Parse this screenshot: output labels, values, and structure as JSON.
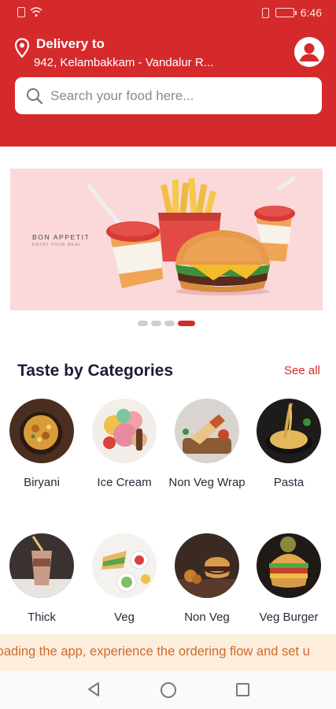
{
  "status_bar": {
    "time": "6:46",
    "icons": [
      "sim-icon",
      "wifi-icon",
      "vibrate-icon",
      "battery-icon"
    ]
  },
  "header": {
    "delivery_label": "Delivery to",
    "address": "942, Kelambakkam - Vandalur R...",
    "icons": [
      "location-pin-icon",
      "profile-icon"
    ]
  },
  "search": {
    "placeholder": "Search your food here...",
    "value": ""
  },
  "banner": {
    "heading": "BON APPETIT",
    "subtext": "ENJOY YOUR MEAL",
    "slides_total": 4,
    "active_slide": 4
  },
  "categories": {
    "title": "Taste by Categories",
    "see_all": "See all",
    "items": [
      {
        "label": "Biryani"
      },
      {
        "label": "Ice Cream"
      },
      {
        "label": "Non Veg Wrap"
      },
      {
        "label": "Pasta"
      },
      {
        "label": "Thick"
      },
      {
        "label": "Veg"
      },
      {
        "label": "Non Veg"
      },
      {
        "label": "Veg Burger"
      }
    ]
  },
  "promo": {
    "text": "loading the app, experience the ordering flow and set u"
  },
  "nav": {
    "icons": [
      "back-icon",
      "home-icon",
      "recents-icon"
    ]
  },
  "colors": {
    "brand_red": "#d52a2c",
    "banner_pink": "#fbd9db",
    "promo_bg": "#fdeede",
    "promo_text": "#d06a2b",
    "title_navy": "#1c1c3a"
  }
}
